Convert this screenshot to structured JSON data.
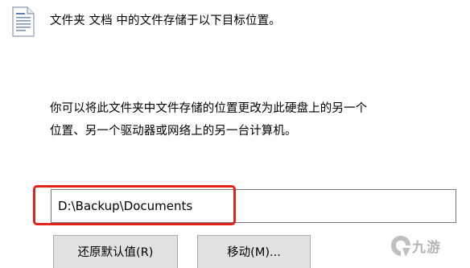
{
  "header": {
    "icon": "document-icon",
    "text": "文件夹 文档 中的文件存储于以下目标位置。"
  },
  "description": {
    "line1": "你可以将此文件夹中文件存储的位置更改为此硬盘上的另一个",
    "line2": "位置、另一个驱动器或网络上的另一台计算机。"
  },
  "path_field": {
    "value": "D:\\Backup\\Documents"
  },
  "buttons": {
    "restore_default": "还原默认值(R)",
    "move": "移动(M)..."
  },
  "watermark": {
    "text": "九游"
  },
  "colors": {
    "highlight": "#e0241b",
    "button_bg": "#e1e1e1",
    "button_border": "#adadad",
    "field_border": "#7a7a7a",
    "watermark": "#b5b5b5"
  }
}
